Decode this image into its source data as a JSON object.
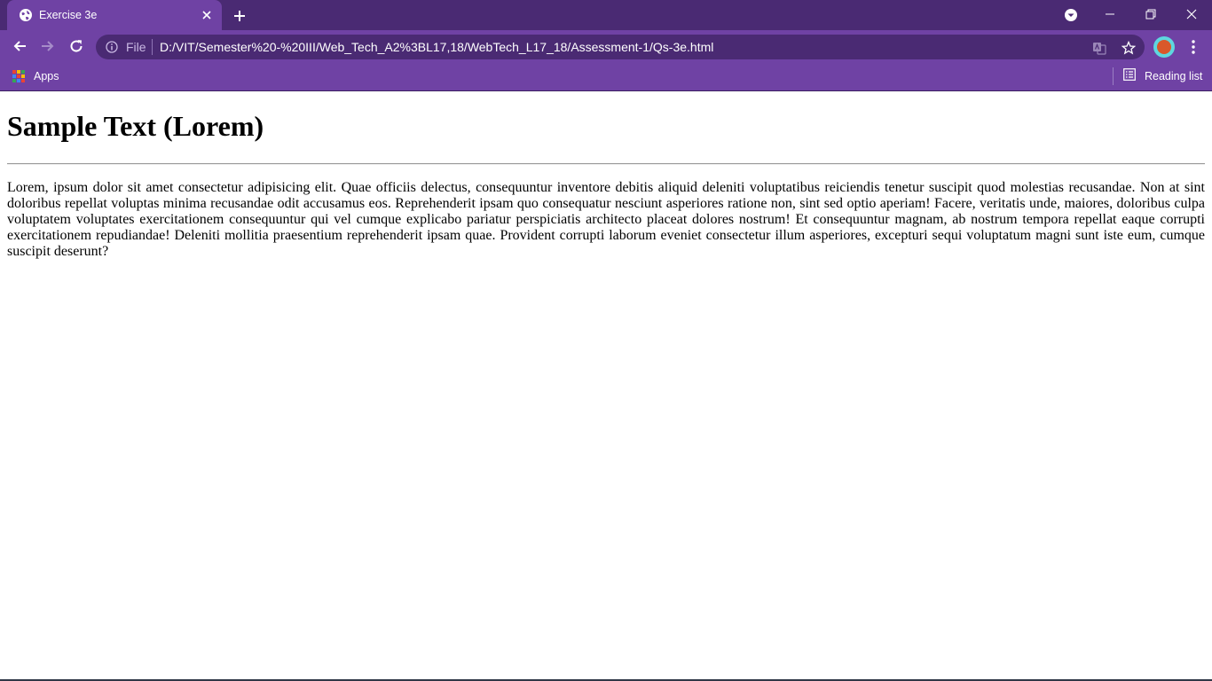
{
  "browser": {
    "tab": {
      "title": "Exercise 3e",
      "favicon": "globe-icon"
    },
    "window_controls": [
      "minimize-icon",
      "restore-icon",
      "close-icon"
    ],
    "toolbar": {
      "file_label": "File",
      "url": "D:/VIT/Semester%20-%20III/Web_Tech_A2%3BL17,18/WebTech_L17_18/Assessment-1/Qs-3e.html"
    },
    "bookmarks": {
      "apps_label": "Apps",
      "reading_list_label": "Reading list"
    },
    "colors": {
      "title_bar": "#4a2a73",
      "toolbar": "#6f42a4",
      "omnibox": "#4a2a73"
    }
  },
  "page": {
    "heading": "Sample Text (Lorem)",
    "paragraph": "Lorem, ipsum dolor sit amet consectetur adipisicing elit. Quae officiis delectus, consequuntur inventore debitis aliquid deleniti voluptatibus reiciendis tenetur suscipit quod molestias recusandae. Non at sint doloribus repellat voluptas minima recusandae odit accusamus eos. Reprehenderit ipsam quo consequatur nesciunt asperiores ratione non, sint sed optio aperiam! Facere, veritatis unde, maiores, doloribus culpa voluptatem voluptates exercitationem consequuntur qui vel cumque explicabo pariatur perspiciatis architecto placeat dolores nostrum! Et consequuntur magnam, ab nostrum tempora repellat eaque corrupti exercitationem repudiandae! Deleniti mollitia praesentium reprehenderit ipsam quae. Provident corrupti laborum eveniet consectetur illum asperiores, excepturi sequi voluptatum magni sunt iste eum, cumque suscipit deserunt?"
  }
}
